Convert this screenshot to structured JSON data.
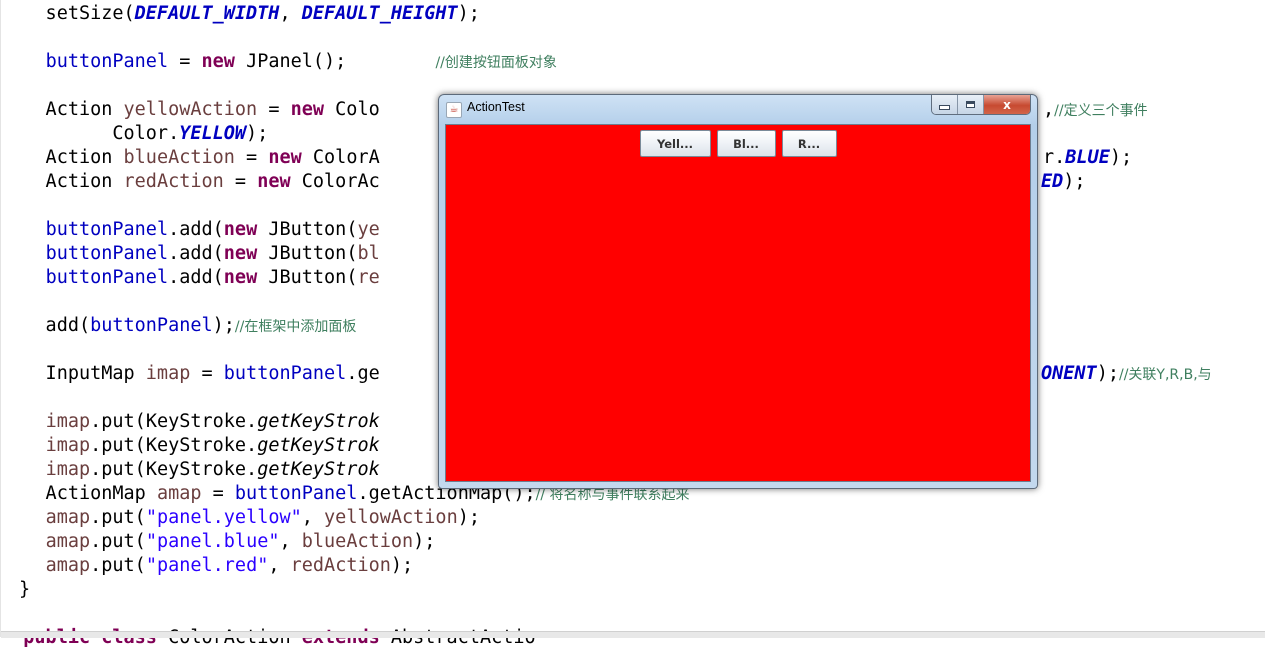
{
  "editor": {
    "lines": {
      "l0": {
        "a": "    setSize(",
        "b": "DEFAULT_WIDTH",
        "c": ", ",
        "d": "DEFAULT_HEIGHT",
        "e": ");"
      },
      "l1": {
        "a": "    ",
        "b": "buttonPanel",
        "c": " = ",
        "d": "new",
        "e": " JPanel();",
        "f": "        ",
        "g": "//创建按钮面板对象"
      },
      "l2": {
        "a": "    Action ",
        "b": "yellowAction",
        "c": " = ",
        "d": "new",
        "e": " Colo",
        "f": "//定义三个事件"
      },
      "l2b": {
        "a": ",",
        "tail": ""
      },
      "l3": {
        "a": "          Color.",
        "b": "YELLOW",
        "c": ");"
      },
      "l4": {
        "a": "    Action ",
        "b": "blueAction",
        "c": " = ",
        "d": "new",
        "e": " ColorA",
        "f": "r.",
        "g": "BLUE",
        "h": ");"
      },
      "l5": {
        "a": "    Action ",
        "b": "redAction",
        "c": " = ",
        "d": "new",
        "e": " ColorAc",
        "f": "ED",
        "g": ");"
      },
      "l6": {
        "a": "    ",
        "b": "buttonPanel",
        "c": ".add(",
        "d": "new",
        "e": " JButton(",
        "f": "ye"
      },
      "l7": {
        "a": "    ",
        "b": "buttonPanel",
        "c": ".add(",
        "d": "new",
        "e": " JButton(",
        "f": "bl"
      },
      "l8": {
        "a": "    ",
        "b": "buttonPanel",
        "c": ".add(",
        "d": "new",
        "e": " JButton(",
        "f": "re"
      },
      "l9": {
        "a": "    add(",
        "b": "buttonPanel",
        "c": ");",
        "d": "//在框架中添加面板"
      },
      "l10": {
        "a": "    InputMap ",
        "b": "imap",
        "c": " = ",
        "d": "buttonPanel",
        "e": ".ge",
        "f": "ONENT",
        "g": ");",
        "h": "//关联Y,R,B,与"
      },
      "l11": {
        "a": "    ",
        "b": "imap",
        "c": ".put(KeyStroke.",
        "d": "getKeyStrok"
      },
      "l12": {
        "a": "    ",
        "b": "imap",
        "c": ".put(KeyStroke.",
        "d": "getKeyStrok"
      },
      "l13": {
        "a": "    ",
        "b": "imap",
        "c": ".put(KeyStroke.",
        "d": "getKeyStrok"
      },
      "l14": {
        "a": "    ActionMap ",
        "b": "amap",
        "c": " = ",
        "d": "buttonPanel",
        "e": ".getActionMap();",
        "f": "// 将名称与事件联系起来"
      },
      "l15": {
        "a": "    ",
        "b": "amap",
        "c": ".put(",
        "d": "\"panel.yellow\"",
        "e": ", ",
        "f": "yellowAction",
        "g": ");"
      },
      "l16": {
        "a": "    ",
        "b": "amap",
        "c": ".put(",
        "d": "\"panel.blue\"",
        "e": ", ",
        "f": "blueAction",
        "g": ");"
      },
      "l17": {
        "a": "    ",
        "b": "amap",
        "c": ".put(",
        "d": "\"panel.red\"",
        "e": ", ",
        "f": "redAction",
        "g": ");"
      },
      "l18": {
        "a": "}"
      },
      "l19": {
        "a": "  ",
        "b": "public",
        "c": " ",
        "d": "class",
        "e": " ColorAction ",
        "f": "extends",
        "g": " AbstractActio"
      }
    }
  },
  "window": {
    "title": "ActionTest",
    "icon": "java-cup-icon",
    "controls": {
      "close_glyph": "x"
    },
    "background_color": "#ff0000",
    "buttons": {
      "yellow": "Yell...",
      "blue": "Bl...",
      "red": "R..."
    }
  }
}
